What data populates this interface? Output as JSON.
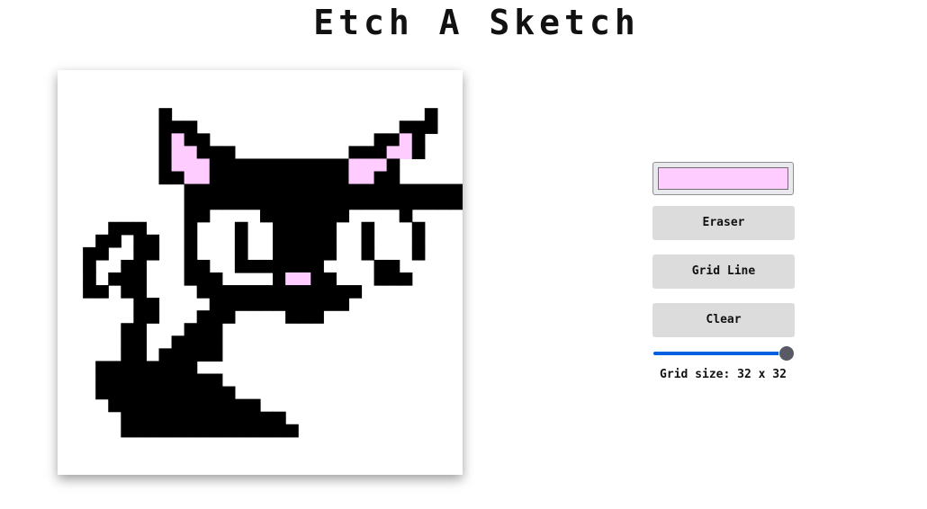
{
  "title": "Etch A Sketch",
  "grid": {
    "size": 32,
    "pen_color": "#ffccff",
    "cells": [
      "................................",
      "................................",
      "................................",
      "........#....................#..",
      "........###................###..",
      "........#p##.............##p#..",
      "........#pp###.........###pp#...",
      "........#ppp###########ppp#.....",
      "........##pp###########pp##.....",
      "..........######################",
      "..........######################",
      "..........##wwww#######wwww#.....",
      "....###...#www#ww#####ww#www#...",
      "...##.##..#www#ww#####ww#www#...",
      "..##..##..#www#ww#####ww#www#...",
      "..#..##...##ww#######wwww##.....",
      "..#.###...###wwww#pp##www###....",
      "..##.##....#############.....",
      "......##....###########....",
      "......##...###....###...",
      ".....##...###...........",
      ".....##..####...........",
      ".....##.#####...........",
      "...########......",
      "...##########....",
      "...###########...",
      "....############.",
      ".....#############",
      ".....##############",
      "................................",
      "................................",
      "................................"
    ]
  },
  "controls": {
    "color_picker": {
      "value": "#ffccff"
    },
    "eraser_label": "Eraser",
    "grid_line_label": "Grid Line",
    "clear_label": "Clear",
    "slider": {
      "min": 1,
      "max": 32,
      "value": 32,
      "fill_color": "#0060df"
    },
    "grid_size_label": "Grid size: 32 x 32"
  }
}
